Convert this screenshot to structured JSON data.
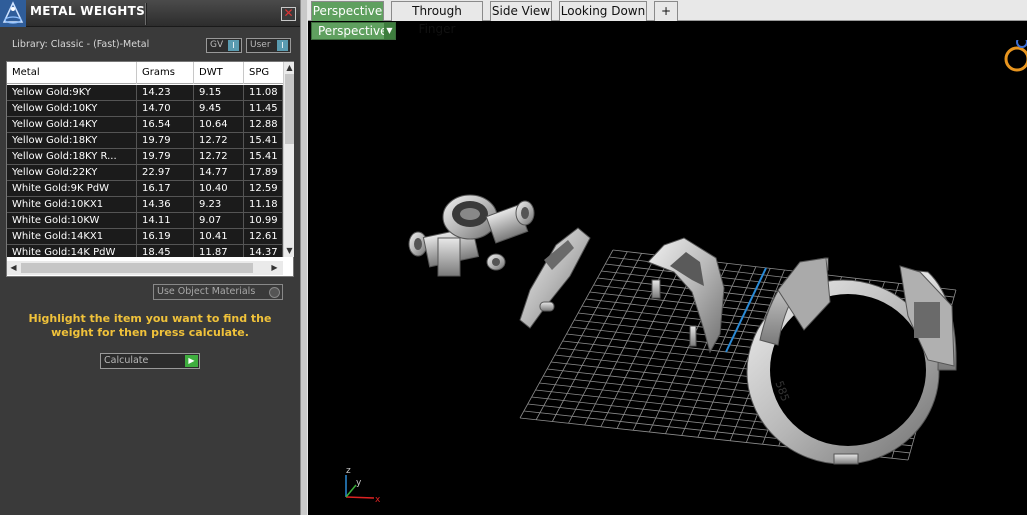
{
  "panel": {
    "title": "METAL WEIGHTS",
    "close_glyph": "✕",
    "library_text": "Library: Classic - (Fast)-Metal",
    "toggles": [
      {
        "label": "GV",
        "knob": "I"
      },
      {
        "label": "User",
        "knob": "I"
      }
    ],
    "table": {
      "headers": [
        "Metal",
        "Grams",
        "DWT",
        "SPG"
      ],
      "rows": [
        [
          "Yellow Gold:9KY",
          "14.23",
          "9.15",
          "11.08"
        ],
        [
          "Yellow Gold:10KY",
          "14.70",
          "9.45",
          "11.45"
        ],
        [
          "Yellow Gold:14KY",
          "16.54",
          "10.64",
          "12.88"
        ],
        [
          "Yellow Gold:18KY",
          "19.79",
          "12.72",
          "15.41"
        ],
        [
          "Yellow Gold:18KY R...",
          "19.79",
          "12.72",
          "15.41"
        ],
        [
          "Yellow Gold:22KY",
          "22.97",
          "14.77",
          "17.89"
        ],
        [
          "White Gold:9K PdW",
          "16.17",
          "10.40",
          "12.59"
        ],
        [
          "White Gold:10KX1",
          "14.36",
          "9.23",
          "11.18"
        ],
        [
          "White Gold:10KW",
          "14.11",
          "9.07",
          "10.99"
        ],
        [
          "White Gold:14KX1",
          "16.19",
          "10.41",
          "12.61"
        ],
        [
          "White Gold:14K PdW",
          "18.45",
          "11.87",
          "14.37"
        ]
      ]
    },
    "use_object_materials": "Use Object Materials",
    "hint": "Highlight the item you want to find the weight for then press calculate.",
    "calculate_label": "Calculate",
    "calculate_go": "▶"
  },
  "viewport": {
    "tabs": [
      "Perspective",
      "Through Finger",
      "Side View",
      "Looking Down",
      "+"
    ],
    "active_tab": "Perspective",
    "view_dropdown": "Perspective",
    "dropdown_arrow": "▼",
    "ring_stamp": "585",
    "axes": {
      "x": "x",
      "y": "y",
      "z": "z"
    }
  },
  "colors": {
    "accent_green": "#5fa05f",
    "hint_yellow": "#f0c23a",
    "axis_red": "#d22",
    "axis_blue": "#2a8ad6"
  }
}
